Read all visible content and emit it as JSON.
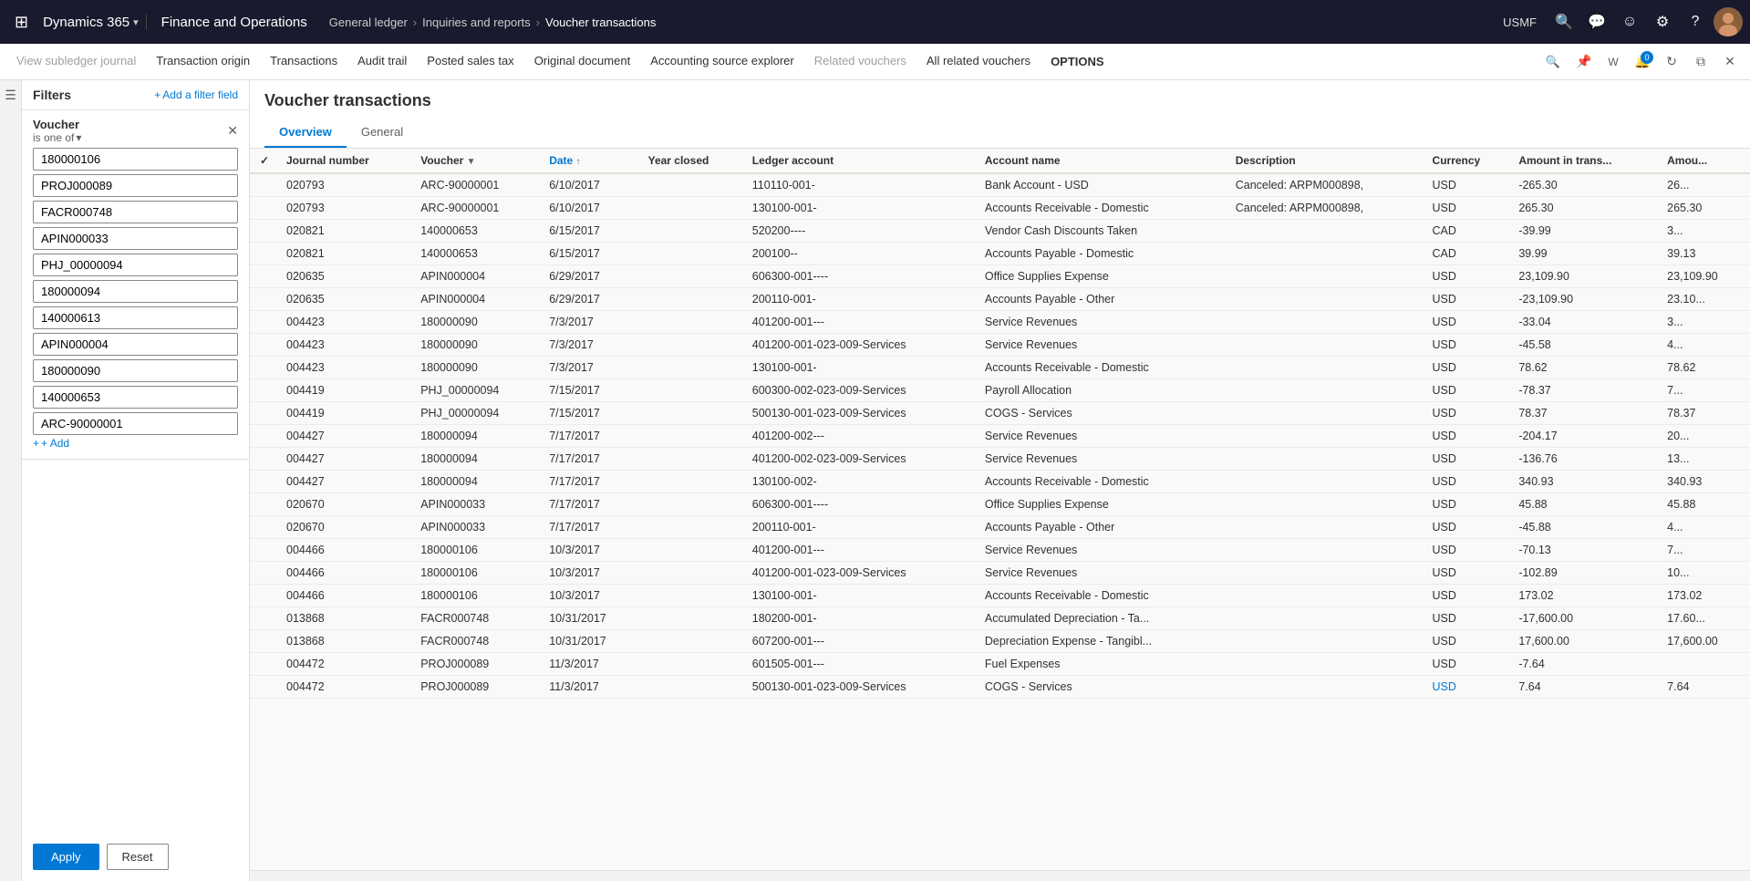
{
  "topbar": {
    "app_grid_icon": "⊞",
    "brand": "Dynamics 365",
    "brand_chevron": "▾",
    "app_title": "Finance and Operations",
    "breadcrumb": [
      {
        "label": "General ledger",
        "sep": "›"
      },
      {
        "label": "Inquiries and reports",
        "sep": "›"
      },
      {
        "label": "Voucher transactions",
        "sep": ""
      }
    ],
    "user_label": "USMF",
    "icons": [
      "🔍",
      "💬",
      "☺",
      "⚙",
      "?"
    ]
  },
  "secondary_nav": {
    "items": [
      {
        "label": "View subledger journal",
        "disabled": true
      },
      {
        "label": "Transaction origin",
        "disabled": false
      },
      {
        "label": "Transactions",
        "disabled": false
      },
      {
        "label": "Audit trail",
        "disabled": false
      },
      {
        "label": "Posted sales tax",
        "disabled": false
      },
      {
        "label": "Original document",
        "disabled": false
      },
      {
        "label": "Accounting source explorer",
        "disabled": false
      },
      {
        "label": "Related vouchers",
        "disabled": true
      },
      {
        "label": "All related vouchers",
        "disabled": false
      },
      {
        "label": "OPTIONS",
        "disabled": false,
        "bold": true
      }
    ]
  },
  "filters": {
    "title": "Filters",
    "add_filter_label": "+ Add a filter field",
    "filter_group": {
      "field_name": "Voucher",
      "condition": "is one of",
      "values": [
        "180000106",
        "PROJ000089",
        "FACR000748",
        "APIN000033",
        "PHJ_00000094",
        "180000094",
        "140000613",
        "APIN000004",
        "180000090",
        "140000653",
        "ARC-90000001"
      ]
    },
    "add_value_label": "+ Add",
    "apply_label": "Apply",
    "reset_label": "Reset"
  },
  "content": {
    "title": "Voucher transactions",
    "tabs": [
      {
        "label": "Overview",
        "active": true
      },
      {
        "label": "General",
        "active": false
      }
    ],
    "table": {
      "columns": [
        {
          "key": "check",
          "label": ""
        },
        {
          "key": "journal_number",
          "label": "Journal number"
        },
        {
          "key": "voucher",
          "label": "Voucher",
          "sort": "filter"
        },
        {
          "key": "date",
          "label": "Date",
          "sort": "asc"
        },
        {
          "key": "year_closed",
          "label": "Year closed"
        },
        {
          "key": "ledger_account",
          "label": "Ledger account"
        },
        {
          "key": "account_name",
          "label": "Account name"
        },
        {
          "key": "description",
          "label": "Description"
        },
        {
          "key": "currency",
          "label": "Currency"
        },
        {
          "key": "amount_in_trans",
          "label": "Amount in trans..."
        },
        {
          "key": "amount",
          "label": "Amou..."
        }
      ],
      "rows": [
        {
          "check": false,
          "journal_number": "020793",
          "voucher": "ARC-90000001",
          "date": "6/10/2017",
          "year_closed": "",
          "ledger_account": "110110-001-",
          "account_name": "Bank Account - USD",
          "description": "Canceled: ARPM000898,",
          "currency": "USD",
          "amount_in_trans": "-265.30",
          "amount": "26...",
          "highlight_currency": false
        },
        {
          "check": false,
          "journal_number": "020793",
          "voucher": "ARC-90000001",
          "date": "6/10/2017",
          "year_closed": "",
          "ledger_account": "130100-001-",
          "account_name": "Accounts Receivable - Domestic",
          "description": "Canceled: ARPM000898,",
          "currency": "USD",
          "amount_in_trans": "265.30",
          "amount": "265.30",
          "highlight_currency": false
        },
        {
          "check": false,
          "journal_number": "020821",
          "voucher": "140000653",
          "date": "6/15/2017",
          "year_closed": "",
          "ledger_account": "520200----",
          "account_name": "Vendor Cash Discounts Taken",
          "description": "",
          "currency": "CAD",
          "amount_in_trans": "-39.99",
          "amount": "3...",
          "highlight_currency": false
        },
        {
          "check": false,
          "journal_number": "020821",
          "voucher": "140000653",
          "date": "6/15/2017",
          "year_closed": "",
          "ledger_account": "200100--",
          "account_name": "Accounts Payable - Domestic",
          "description": "",
          "currency": "CAD",
          "amount_in_trans": "39.99",
          "amount": "39.13",
          "highlight_currency": false
        },
        {
          "check": false,
          "journal_number": "020635",
          "voucher": "APIN000004",
          "date": "6/29/2017",
          "year_closed": "",
          "ledger_account": "606300-001----",
          "account_name": "Office Supplies Expense",
          "description": "",
          "currency": "USD",
          "amount_in_trans": "23,109.90",
          "amount": "23,109.90",
          "highlight_currency": false
        },
        {
          "check": false,
          "journal_number": "020635",
          "voucher": "APIN000004",
          "date": "6/29/2017",
          "year_closed": "",
          "ledger_account": "200110-001-",
          "account_name": "Accounts Payable - Other",
          "description": "",
          "currency": "USD",
          "amount_in_trans": "-23,109.90",
          "amount": "23.10...",
          "highlight_currency": false
        },
        {
          "check": false,
          "journal_number": "004423",
          "voucher": "180000090",
          "date": "7/3/2017",
          "year_closed": "",
          "ledger_account": "401200-001---",
          "account_name": "Service Revenues",
          "description": "",
          "currency": "USD",
          "amount_in_trans": "-33.04",
          "amount": "3...",
          "highlight_currency": false
        },
        {
          "check": false,
          "journal_number": "004423",
          "voucher": "180000090",
          "date": "7/3/2017",
          "year_closed": "",
          "ledger_account": "401200-001-023-009-Services",
          "account_name": "Service Revenues",
          "description": "",
          "currency": "USD",
          "amount_in_trans": "-45.58",
          "amount": "4...",
          "highlight_currency": false
        },
        {
          "check": false,
          "journal_number": "004423",
          "voucher": "180000090",
          "date": "7/3/2017",
          "year_closed": "",
          "ledger_account": "130100-001-",
          "account_name": "Accounts Receivable - Domestic",
          "description": "",
          "currency": "USD",
          "amount_in_trans": "78.62",
          "amount": "78.62",
          "highlight_currency": false
        },
        {
          "check": false,
          "journal_number": "004419",
          "voucher": "PHJ_00000094",
          "date": "7/15/2017",
          "year_closed": "",
          "ledger_account": "600300-002-023-009-Services",
          "account_name": "Payroll Allocation",
          "description": "",
          "currency": "USD",
          "amount_in_trans": "-78.37",
          "amount": "7...",
          "highlight_currency": false
        },
        {
          "check": false,
          "journal_number": "004419",
          "voucher": "PHJ_00000094",
          "date": "7/15/2017",
          "year_closed": "",
          "ledger_account": "500130-001-023-009-Services",
          "account_name": "COGS - Services",
          "description": "",
          "currency": "USD",
          "amount_in_trans": "78.37",
          "amount": "78.37",
          "highlight_currency": false
        },
        {
          "check": false,
          "journal_number": "004427",
          "voucher": "180000094",
          "date": "7/17/2017",
          "year_closed": "",
          "ledger_account": "401200-002---",
          "account_name": "Service Revenues",
          "description": "",
          "currency": "USD",
          "amount_in_trans": "-204.17",
          "amount": "20...",
          "highlight_currency": false
        },
        {
          "check": false,
          "journal_number": "004427",
          "voucher": "180000094",
          "date": "7/17/2017",
          "year_closed": "",
          "ledger_account": "401200-002-023-009-Services",
          "account_name": "Service Revenues",
          "description": "",
          "currency": "USD",
          "amount_in_trans": "-136.76",
          "amount": "13...",
          "highlight_currency": false
        },
        {
          "check": false,
          "journal_number": "004427",
          "voucher": "180000094",
          "date": "7/17/2017",
          "year_closed": "",
          "ledger_account": "130100-002-",
          "account_name": "Accounts Receivable - Domestic",
          "description": "",
          "currency": "USD",
          "amount_in_trans": "340.93",
          "amount": "340.93",
          "highlight_currency": false
        },
        {
          "check": false,
          "journal_number": "020670",
          "voucher": "APIN000033",
          "date": "7/17/2017",
          "year_closed": "",
          "ledger_account": "606300-001----",
          "account_name": "Office Supplies Expense",
          "description": "",
          "currency": "USD",
          "amount_in_trans": "45.88",
          "amount": "45.88",
          "highlight_currency": false
        },
        {
          "check": false,
          "journal_number": "020670",
          "voucher": "APIN000033",
          "date": "7/17/2017",
          "year_closed": "",
          "ledger_account": "200110-001-",
          "account_name": "Accounts Payable - Other",
          "description": "",
          "currency": "USD",
          "amount_in_trans": "-45.88",
          "amount": "4...",
          "highlight_currency": false
        },
        {
          "check": false,
          "journal_number": "004466",
          "voucher": "180000106",
          "date": "10/3/2017",
          "year_closed": "",
          "ledger_account": "401200-001---",
          "account_name": "Service Revenues",
          "description": "",
          "currency": "USD",
          "amount_in_trans": "-70.13",
          "amount": "7...",
          "highlight_currency": false
        },
        {
          "check": false,
          "journal_number": "004466",
          "voucher": "180000106",
          "date": "10/3/2017",
          "year_closed": "",
          "ledger_account": "401200-001-023-009-Services",
          "account_name": "Service Revenues",
          "description": "",
          "currency": "USD",
          "amount_in_trans": "-102.89",
          "amount": "10...",
          "highlight_currency": false
        },
        {
          "check": false,
          "journal_number": "004466",
          "voucher": "180000106",
          "date": "10/3/2017",
          "year_closed": "",
          "ledger_account": "130100-001-",
          "account_name": "Accounts Receivable - Domestic",
          "description": "",
          "currency": "USD",
          "amount_in_trans": "173.02",
          "amount": "173.02",
          "highlight_currency": false
        },
        {
          "check": false,
          "journal_number": "013868",
          "voucher": "FACR000748",
          "date": "10/31/2017",
          "year_closed": "",
          "ledger_account": "180200-001-",
          "account_name": "Accumulated Depreciation - Ta...",
          "description": "",
          "currency": "USD",
          "amount_in_trans": "-17,600.00",
          "amount": "17.60...",
          "highlight_currency": false
        },
        {
          "check": false,
          "journal_number": "013868",
          "voucher": "FACR000748",
          "date": "10/31/2017",
          "year_closed": "",
          "ledger_account": "607200-001---",
          "account_name": "Depreciation Expense - Tangibl...",
          "description": "",
          "currency": "USD",
          "amount_in_trans": "17,600.00",
          "amount": "17,600.00",
          "highlight_currency": false
        },
        {
          "check": false,
          "journal_number": "004472",
          "voucher": "PROJ000089",
          "date": "11/3/2017",
          "year_closed": "",
          "ledger_account": "601505-001---",
          "account_name": "Fuel Expenses",
          "description": "",
          "currency": "USD",
          "amount_in_trans": "-7.64",
          "amount": "",
          "highlight_currency": false
        },
        {
          "check": false,
          "journal_number": "004472",
          "voucher": "PROJ000089",
          "date": "11/3/2017",
          "year_closed": "",
          "ledger_account": "500130-001-023-009-Services",
          "account_name": "COGS - Services",
          "description": "",
          "currency": "USD",
          "amount_in_trans": "7.64",
          "amount": "7.64",
          "highlight_currency": true
        }
      ]
    }
  }
}
